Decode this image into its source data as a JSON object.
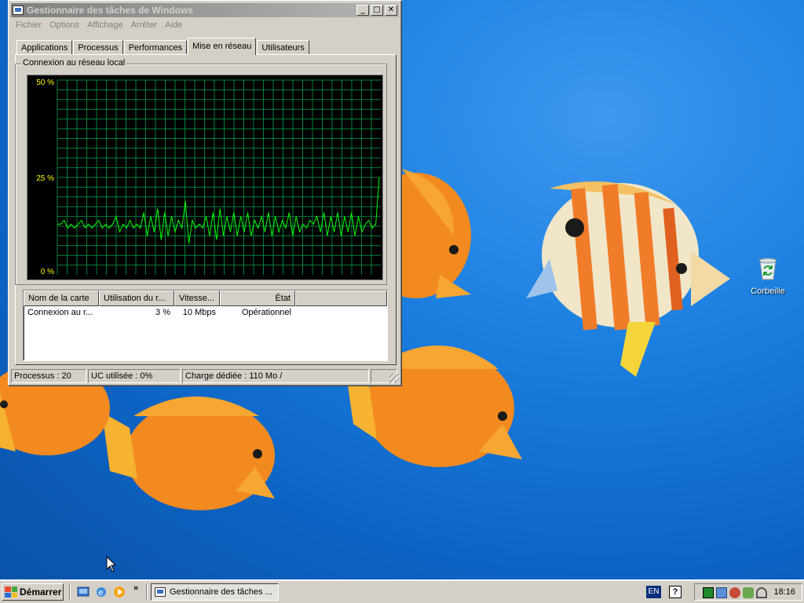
{
  "window": {
    "title": "Gestionnaire des tâches de Windows",
    "buttons": {
      "minimize": "_",
      "maximize": "□",
      "close": "✕"
    }
  },
  "menu": [
    "Fichier",
    "Options",
    "Affichage",
    "Arrêter",
    "Aide"
  ],
  "tabs": [
    "Applications",
    "Processus",
    "Performances",
    "Mise en réseau",
    "Utilisateurs"
  ],
  "active_tab": "Mise en réseau",
  "network": {
    "group_title": "Connexion au réseau local",
    "y_labels": [
      "50 %",
      "25 %",
      "0 %"
    ],
    "columns": [
      "Nom de la carte",
      "Utilisation du r...",
      "Vitesse...",
      "État"
    ],
    "rows": [
      {
        "name": "Connexion au r...",
        "usage": "3 %",
        "speed": "10 Mbps",
        "state": "Opérationnel"
      }
    ]
  },
  "chart_data": {
    "type": "line",
    "title": "Connexion au réseau local",
    "ylim": [
      0,
      50
    ],
    "y_ticks": [
      "0 %",
      "25 %",
      "50 %"
    ],
    "grid": true,
    "series": [
      {
        "color": "#00ff00",
        "values": [
          13,
          13,
          14,
          12,
          13,
          12,
          13,
          14,
          12,
          13,
          12,
          13,
          14,
          12,
          13,
          12,
          13,
          15,
          11,
          13,
          12,
          14,
          12,
          13,
          12,
          16,
          10,
          15,
          11,
          17,
          9,
          16,
          10,
          15,
          11,
          14,
          12,
          19,
          8,
          14,
          12,
          13,
          12,
          15,
          10,
          16,
          9,
          17,
          10,
          15,
          11,
          16,
          10,
          15,
          11,
          16,
          10,
          14,
          12,
          15,
          11,
          16,
          10,
          15,
          11,
          14,
          12,
          16,
          10,
          15,
          11,
          13,
          12,
          14,
          13,
          15,
          11,
          16,
          10,
          15,
          11,
          16,
          10,
          15,
          11,
          16,
          10,
          15,
          11,
          13,
          14,
          12,
          13,
          25
        ]
      }
    ]
  },
  "status": {
    "processes": "Processus : 20",
    "cpu": "UC utilisée : 0%",
    "commit": "Charge dédiée : 110 Mo /"
  },
  "desktop": {
    "recycle_bin": "Corbeille"
  },
  "taskbar": {
    "start": "Démarrer",
    "quick_launch_more": "»",
    "task": "Gestionnaire des tâches ...",
    "lang": "EN",
    "help": "?",
    "clock": "18:16"
  }
}
